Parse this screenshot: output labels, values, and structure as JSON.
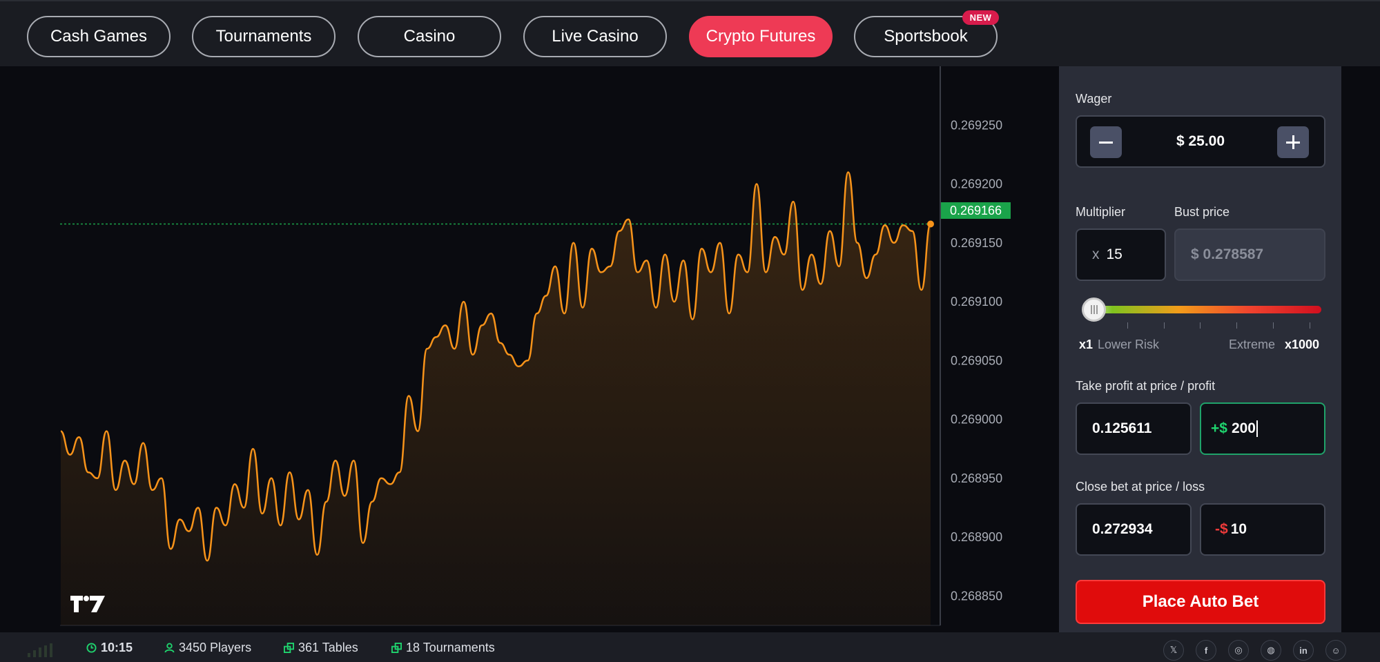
{
  "nav": {
    "tabs": [
      {
        "label": "Cash Games"
      },
      {
        "label": "Tournaments"
      },
      {
        "label": "Casino"
      },
      {
        "label": "Live Casino"
      },
      {
        "label": "Crypto Futures"
      },
      {
        "label": "Sportsbook"
      }
    ],
    "active_tab": "Crypto Futures",
    "new_badge": "NEW",
    "accent_color": "#ee3a55"
  },
  "chart": {
    "current_price": "0.269166",
    "line_color": "#f7931a",
    "price_line_color": "#1aa34a",
    "logo": "TV",
    "y_ticks": [
      "0.269250",
      "0.269200",
      "0.269150",
      "0.269100",
      "0.269050",
      "0.269000",
      "0.268950",
      "0.268900",
      "0.268850"
    ]
  },
  "chart_data": {
    "type": "line",
    "ylim": [
      0.268825,
      0.2693
    ],
    "current_value": 0.269166,
    "values": [
      0.26899,
      0.26897,
      0.268985,
      0.268955,
      0.26895,
      0.26899,
      0.26894,
      0.268965,
      0.268945,
      0.26898,
      0.26894,
      0.26895,
      0.26889,
      0.268915,
      0.268905,
      0.268925,
      0.26888,
      0.268925,
      0.26891,
      0.268945,
      0.268925,
      0.268975,
      0.26892,
      0.26895,
      0.26891,
      0.268955,
      0.268915,
      0.26894,
      0.268885,
      0.26893,
      0.268965,
      0.268935,
      0.268965,
      0.268895,
      0.26893,
      0.26895,
      0.268945,
      0.268955,
      0.26902,
      0.26899,
      0.26906,
      0.26907,
      0.26908,
      0.26906,
      0.2691,
      0.269055,
      0.26908,
      0.26909,
      0.269065,
      0.269055,
      0.269045,
      0.26905,
      0.26909,
      0.269105,
      0.26913,
      0.26909,
      0.26915,
      0.269095,
      0.269145,
      0.269125,
      0.26913,
      0.26916,
      0.26917,
      0.269125,
      0.269135,
      0.269095,
      0.26914,
      0.2691,
      0.269135,
      0.269085,
      0.269145,
      0.269125,
      0.26915,
      0.26909,
      0.26914,
      0.269125,
      0.2692,
      0.269125,
      0.269155,
      0.26914,
      0.269185,
      0.26911,
      0.26914,
      0.269115,
      0.26916,
      0.26913,
      0.26921,
      0.26915,
      0.26912,
      0.26914,
      0.269165,
      0.26915,
      0.269165,
      0.26916,
      0.26911,
      0.269166
    ]
  },
  "panel": {
    "wager_label": "Wager",
    "wager_value": "$ 25.00",
    "minus_icon": "minus-icon",
    "plus_icon": "plus-icon",
    "multiplier_label": "Multiplier",
    "multiplier_prefix": "x",
    "multiplier_value": "15",
    "bust_label": "Bust price",
    "bust_value": "$ 0.278587",
    "slider": {
      "min_label": "x1",
      "low_label": "Lower Risk",
      "high_label": "Extreme",
      "max_label": "x1000",
      "value": 15
    },
    "take_profit_label": "Take profit at price / profit",
    "take_profit_price": "0.125611",
    "take_profit_prefix": "+$",
    "take_profit_amount": "200",
    "close_bet_label": "Close bet at price / loss",
    "close_bet_price": "0.272934",
    "close_bet_prefix": "-$",
    "close_bet_amount": "10",
    "place_button": "Place Auto Bet",
    "profit_color": "#1fd46e",
    "loss_color": "#ee3a3a"
  },
  "footer": {
    "time": "10:15",
    "players": "3450 Players",
    "tables": "361 Tables",
    "tournaments": "18 Tournaments",
    "social": [
      "x-icon",
      "facebook-icon",
      "instagram-icon",
      "discord-icon",
      "linkedin-icon",
      "reddit-icon"
    ]
  }
}
